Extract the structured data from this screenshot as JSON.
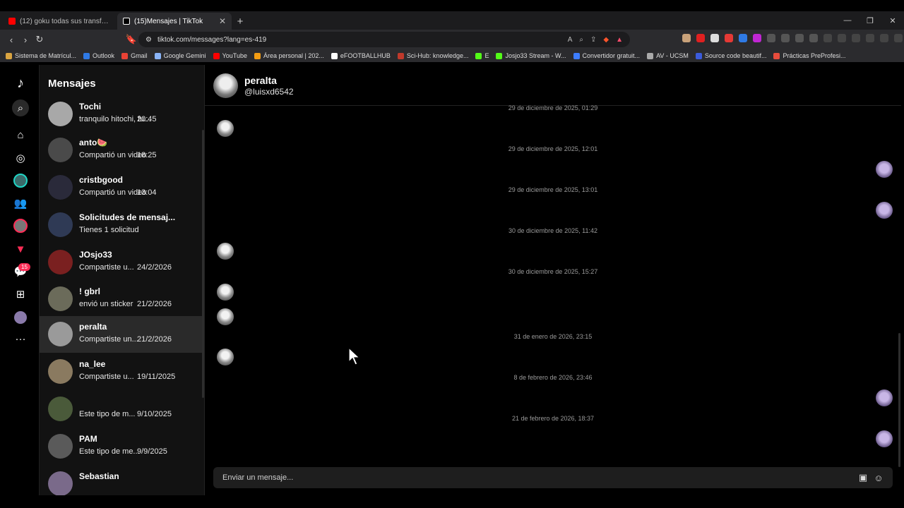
{
  "browser": {
    "tabs": [
      {
        "title": "(12) goku todas sus transformacio",
        "fav_color": "#ff0000"
      },
      {
        "title": "(15)Mensajes | TikTok",
        "fav_color": "#000000"
      }
    ],
    "url": "tiktok.com/messages?lang=es-419",
    "bookmarks": [
      {
        "label": "Sistema de Matrícul...",
        "color": "#d9a441"
      },
      {
        "label": "Outlook",
        "color": "#2f7ae5"
      },
      {
        "label": "Gmail",
        "color": "#e94235"
      },
      {
        "label": "Google Gemini",
        "color": "#8ab4f8"
      },
      {
        "label": "YouTube",
        "color": "#ff0000"
      },
      {
        "label": "Área personal | 202...",
        "color": "#f39c12"
      },
      {
        "label": "eFOOTBALLHUB",
        "color": "#ffffff"
      },
      {
        "label": "Sci-Hub: knowledge...",
        "color": "#c0392b"
      },
      {
        "label": "E",
        "color": "#53fc18"
      },
      {
        "label": "Josjo33 Stream - W...",
        "color": "#53fc18"
      },
      {
        "label": "Convertidor gratuit...",
        "color": "#3d7dff"
      },
      {
        "label": "AV - UCSM",
        "color": "#aaaaaa"
      },
      {
        "label": "Source code beautif...",
        "color": "#3b5bdb"
      },
      {
        "label": "Prácticas PreProfesi...",
        "color": "#e74c3c"
      }
    ]
  },
  "tiktok": {
    "sidebar_title": "Mensajes",
    "inbox_badge": "15",
    "conversations": [
      {
        "name": "Tochi",
        "preview": "tranquilo hitochi, fu...",
        "time": "20:45",
        "avatar": "#a8a8a8"
      },
      {
        "name": "anto🍉",
        "preview": "Compartió un video",
        "time": "18:25",
        "avatar": "#4a4a4a"
      },
      {
        "name": "cristbgood",
        "preview": "Compartió un video",
        "time": "13:04",
        "avatar": "#2a2a3a"
      },
      {
        "name": "Solicitudes de mensaj...",
        "preview": "Tienes 1 solicitud",
        "time": "",
        "avatar": "#2f3a55"
      },
      {
        "name": "JOsjo33",
        "preview": "Compartiste u...",
        "time": "24/2/2026",
        "avatar": "#7a2020"
      },
      {
        "name": "! gbrl",
        "preview": "envió un sticker",
        "time": "21/2/2026",
        "avatar": "#6b6b5a"
      },
      {
        "name": "peralta",
        "preview": "Compartiste un...",
        "time": "21/2/2026",
        "avatar": "#9a9a9a"
      },
      {
        "name": "na_lee",
        "preview": "Compartiste u...",
        "time": "19/11/2025",
        "avatar": "#8a7a60"
      },
      {
        "name": "",
        "preview": "Este tipo de m...",
        "time": "9/10/2025",
        "avatar": "#4a5a3a"
      },
      {
        "name": "PAM",
        "preview": "Este tipo de me...",
        "time": "9/9/2025",
        "avatar": "#5a5a5a"
      },
      {
        "name": "Sebastian",
        "preview": "",
        "time": "",
        "avatar": "#7a6a8a"
      }
    ],
    "chat": {
      "name": "peralta",
      "handle": "@luisxd6542",
      "timestamps": [
        "29 de diciembre de 2025, 01:29",
        "29 de diciembre de 2025, 12:01",
        "29 de diciembre de 2025, 13:01",
        "30 de diciembre de 2025, 11:42",
        "30 de diciembre de 2025, 15:27",
        "31 de enero de 2026, 23:15",
        "8 de febrero de 2026, 23:46",
        "21 de febrero de 2026, 18:37"
      ],
      "composer_placeholder": "Enviar un mensaje..."
    }
  }
}
